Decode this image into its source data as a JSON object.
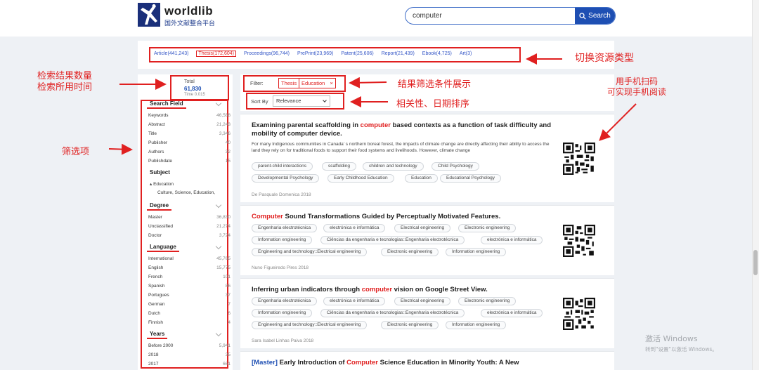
{
  "brand": {
    "name": "worldlib",
    "subtitle": "国外文献整合平台"
  },
  "search": {
    "query": "computer",
    "button_label": "Search"
  },
  "resource_types": [
    {
      "label": "Article(441,243)",
      "active": false
    },
    {
      "label": "Thesis(172,604)",
      "active": true
    },
    {
      "label": "Proceedings(96,744)",
      "active": false
    },
    {
      "label": "PrePrint(23,969)",
      "active": false
    },
    {
      "label": "Patent(25,606)",
      "active": false
    },
    {
      "label": "Report(21,439)",
      "active": false
    },
    {
      "label": "Ebook(4,725)",
      "active": false
    },
    {
      "label": "Art(3)",
      "active": false
    }
  ],
  "summary": {
    "total_label": "Total",
    "total_value": "61,830",
    "time_label": "Time 0.015"
  },
  "facets": {
    "search_field": {
      "title": "Search Field",
      "rows": [
        {
          "label": "Keywords",
          "count": "46,588"
        },
        {
          "label": "Abstract",
          "count": "21,243"
        },
        {
          "label": "Title",
          "count": "3,346"
        },
        {
          "label": "Publisher",
          "count": "40"
        },
        {
          "label": "Authors",
          "count": "32"
        },
        {
          "label": "Publishdate",
          "count": "15"
        }
      ]
    },
    "subject": {
      "title": "Subject",
      "items": [
        "Education",
        "Culture, Science, Education,"
      ]
    },
    "degree": {
      "title": "Degree",
      "rows": [
        {
          "label": "Master",
          "count": "36,830"
        },
        {
          "label": "Unclassified",
          "count": "21,274"
        },
        {
          "label": "Doctor",
          "count": "3,724"
        }
      ]
    },
    "language": {
      "title": "Language",
      "rows": [
        {
          "label": "International",
          "count": "45,765"
        },
        {
          "label": "English",
          "count": "15,775"
        },
        {
          "label": "French",
          "count": "101"
        },
        {
          "label": "Spanish",
          "count": "86"
        },
        {
          "label": "Portugues",
          "count": "37"
        },
        {
          "label": "German",
          "count": "7"
        },
        {
          "label": "Dutch",
          "count": "6"
        },
        {
          "label": "Finnish",
          "count": "4"
        }
      ]
    },
    "years": {
      "title": "Years",
      "rows": [
        {
          "label": "Before 2000",
          "count": "5,941"
        },
        {
          "label": "2018",
          "count": "35"
        },
        {
          "label": "2017",
          "count": "661"
        }
      ]
    }
  },
  "filter": {
    "label": "Filter:",
    "tags": [
      "Thesis",
      "Education",
      "×"
    ]
  },
  "sort": {
    "label": "Sort By",
    "selected": "Relevance"
  },
  "results": [
    {
      "title_pre": "Examining parental scaffolding in ",
      "title_hl": "computer",
      "title_post": " based contexts as a function of task difficulty and mobility of computer device.",
      "abstract": "For many Indigenous communities in Canada’ s northern boreal forest, the impacts of climate change are directly affecting their ability to access the land they rely on for traditional foods to support their food systems and livelihoods. However, climate change",
      "chips": [
        "parent-child interactions",
        "scaffolding",
        "children and technology",
        "Child Psychology",
        "Developmental Psychology",
        "Early Childhood Education",
        "Education",
        "Educational Psychology"
      ],
      "author": "De Pasquale   Domenica   2018"
    },
    {
      "title_hl": "Computer",
      "title_post": " Sound Transformations Guided by Perceptually Motivated Features.",
      "chips": [
        "Engenharia electrotécnica",
        "electrónica e informática",
        "Electrical engineering",
        "Electronic engineering",
        "Information engineering",
        "Ciências da engenharia e tecnologias::Engenharia electrotécnica",
        "electrónica e informática",
        "Engineering and technology::Electrical engineering",
        "Electronic engineering",
        "Information engineering"
      ],
      "author": "Nuno Figueiredo Pires   2018"
    },
    {
      "title_pre": "Inferring urban indicators through ",
      "title_hl": "computer",
      "title_post": " vision on Google Street View.",
      "chips": [
        "Engenharia electrotécnica",
        "electrónica e informática",
        "Electrical engineering",
        "Electronic engineering",
        "Information engineering",
        "Ciências da engenharia e tecnologias::Engenharia electrotécnica",
        "electrónica e informática",
        "Engineering and technology::Electrical engineering",
        "Electronic engineering",
        "Information engineering"
      ],
      "author": "Sara Isabel Linhas Paiva   2018"
    },
    {
      "degree": "[Master]",
      "title_pre": " Early Introduction of ",
      "title_hl": "Computer",
      "title_post": " Science Education in Minority Youth: A New"
    }
  ],
  "annotations": {
    "count_time": [
      "检索结果数量",
      "检索所用时间"
    ],
    "switch_type": "切换资源类型",
    "filter_show": "结果筛选条件展示",
    "sort_hint": "相关性、日期排序",
    "mobile_read": [
      "用手机扫码",
      "可实现手机阅读"
    ],
    "facet_hint": "筛选项"
  },
  "watermark": {
    "title": "激活 Windows",
    "subtitle": "转到\"设置\"以激活 Windows。"
  },
  "colors": {
    "accent_blue": "#1e4fb3",
    "highlight_red": "#e02020",
    "annotation_red": "#e02020"
  }
}
